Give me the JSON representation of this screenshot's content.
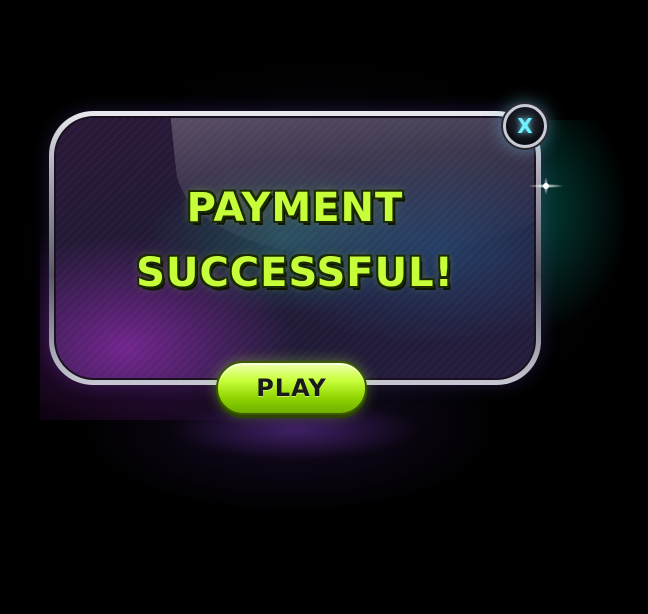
{
  "popup": {
    "title_line1": "PAYMENT",
    "title_line2": "SUCCESSFUL!",
    "close_label": "X",
    "play_label": "PLAY"
  },
  "colors": {
    "title_text": "#c6ff3a",
    "play_button": "#c8ff3a",
    "close_glyph": "#6ff0ff",
    "background": "#000000"
  },
  "icons": {
    "close": "close-icon"
  }
}
